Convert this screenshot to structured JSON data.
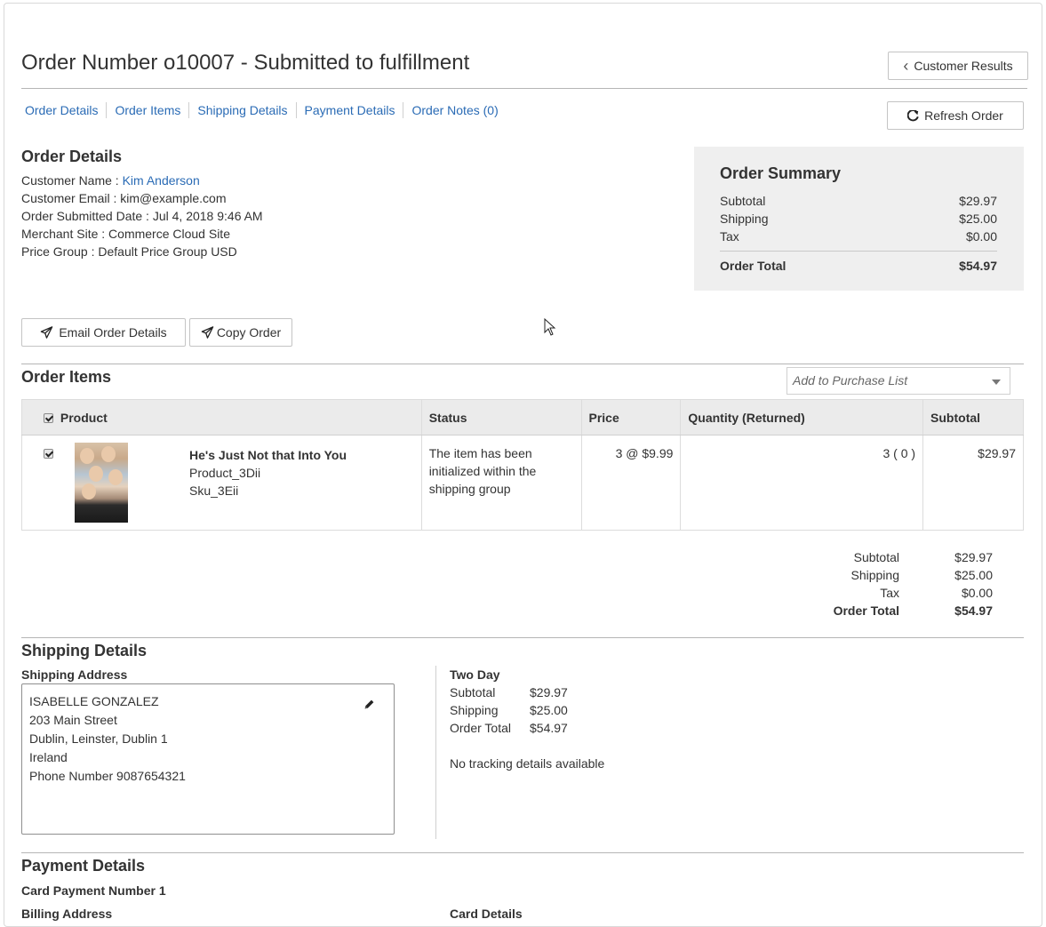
{
  "header": {
    "title": "Order Number o10007 - Submitted to fulfillment",
    "customer_results_label": "Customer Results",
    "refresh_label": "Refresh Order"
  },
  "tabs": [
    {
      "label": "Order Details"
    },
    {
      "label": "Order Items"
    },
    {
      "label": "Shipping Details"
    },
    {
      "label": "Payment Details"
    },
    {
      "label": "Order Notes (0)"
    }
  ],
  "order_details": {
    "title": "Order Details",
    "customer_name_label": "Customer Name : ",
    "customer_name": "Kim Anderson",
    "customer_email": "Customer Email : kim@example.com",
    "submitted_date": "Order Submitted Date : Jul 4, 2018 9:46 AM",
    "merchant_site": "Merchant Site : Commerce Cloud Site",
    "price_group": "Price Group : Default Price Group USD"
  },
  "summary": {
    "title": "Order Summary",
    "subtotal_label": "Subtotal",
    "subtotal": "$29.97",
    "shipping_label": "Shipping",
    "shipping": "$25.00",
    "tax_label": "Tax",
    "tax": "$0.00",
    "total_label": "Order Total",
    "total": "$54.97"
  },
  "actions": {
    "email_label": "Email Order Details",
    "copy_label": "Copy Order"
  },
  "order_items": {
    "title": "Order Items",
    "purchase_list_placeholder": "Add to Purchase List",
    "columns": {
      "product": "Product",
      "status": "Status",
      "price": "Price",
      "quantity": "Quantity (Returned)",
      "subtotal": "Subtotal"
    },
    "rows": [
      {
        "name": "He's Just Not that Into You",
        "product_id": "Product_3Dii",
        "sku": "Sku_3Eii",
        "status": "The item has been initialized within the shipping group",
        "price": "3 @ $9.99",
        "quantity": "3 ( 0 )",
        "subtotal": "$29.97"
      }
    ],
    "totals": {
      "subtotal_label": "Subtotal",
      "subtotal": "$29.97",
      "shipping_label": "Shipping",
      "shipping": "$25.00",
      "tax_label": "Tax",
      "tax": "$0.00",
      "total_label": "Order Total",
      "total": "$54.97"
    }
  },
  "shipping": {
    "title": "Shipping Details",
    "address_label": "Shipping Address",
    "address": {
      "name": "ISABELLE GONZALEZ",
      "street": "203 Main Street",
      "city": "Dublin, Leinster, Dublin 1",
      "country": "Ireland",
      "phone": "Phone Number 9087654321"
    },
    "method": "Two Day",
    "subtotal_label": "Subtotal",
    "subtotal": "$29.97",
    "shipping_label": "Shipping",
    "shipping": "$25.00",
    "total_label": "Order Total",
    "total": "$54.97",
    "tracking": "No tracking details available"
  },
  "payment": {
    "title": "Payment Details",
    "card_payment": "Card Payment Number 1",
    "billing_address_label": "Billing Address",
    "card_details_label": "Card Details"
  }
}
